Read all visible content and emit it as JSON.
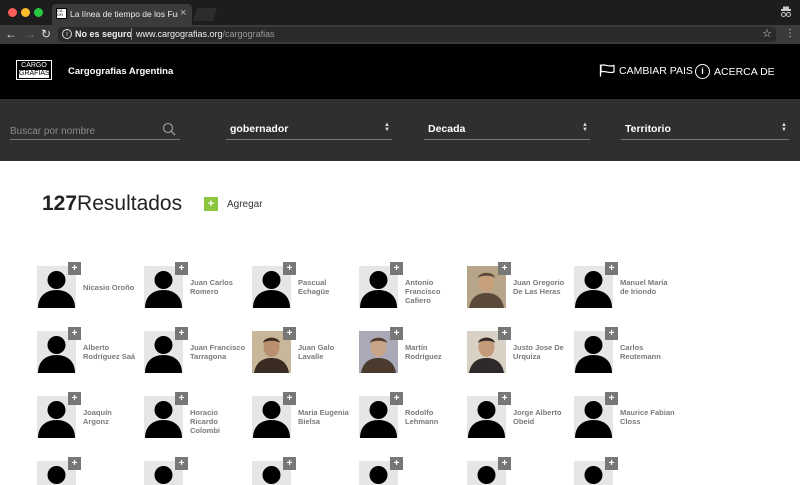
{
  "browser": {
    "tab_title": "La línea de tiempo de los Func",
    "favicon_text": "CA GR",
    "not_secure": "No es seguro",
    "url_host": "www.cargografias.org",
    "url_path": "/cargografias"
  },
  "header": {
    "logo_line1": "CARGO",
    "logo_line2": "GRAFIAS",
    "site_title": "Cargografias Argentina",
    "change_country": "CAMBIAR PAIS",
    "about": "ACERCA DE"
  },
  "filters": {
    "search_placeholder": "Buscar por nombre",
    "cargo": "gobernador",
    "decada": "Decada",
    "territorio": "Territorio"
  },
  "results": {
    "count": "127",
    "label": "Resultados",
    "add_label": "Agregar"
  },
  "people": [
    {
      "name": "Nicasio Oroño",
      "photo": false
    },
    {
      "name": "Juan Carlos Romero",
      "photo": false
    },
    {
      "name": "Pascual Echagüe",
      "photo": false
    },
    {
      "name": "Antonio Francisco Cafiero",
      "photo": false
    },
    {
      "name": "Juan Gregorio De Las Heras",
      "photo": true
    },
    {
      "name": "Manuel María de Iriondo",
      "photo": false
    },
    {
      "name": "Alberto Rodríguez Saá",
      "photo": false
    },
    {
      "name": "Juan Francisco Tarragona",
      "photo": false
    },
    {
      "name": "Juan Galo Lavalle",
      "photo": true
    },
    {
      "name": "Martín Rodríguez",
      "photo": true
    },
    {
      "name": "Justo Jose De Urquiza",
      "photo": true
    },
    {
      "name": "Carlos Reutemann",
      "photo": false
    },
    {
      "name": "Joaquín Argonz",
      "photo": false
    },
    {
      "name": "Horacio Ricardo Colombi",
      "photo": false
    },
    {
      "name": "Maria Eugenia Bielsa",
      "photo": false
    },
    {
      "name": "Rodolfo Lehmann",
      "photo": false
    },
    {
      "name": "Jorge Alberto Obeid",
      "photo": false
    },
    {
      "name": "Maurice Fabian Closs",
      "photo": false
    },
    {
      "name": "",
      "photo": false
    },
    {
      "name": "",
      "photo": false
    },
    {
      "name": "",
      "photo": false
    },
    {
      "name": "",
      "photo": false
    },
    {
      "name": "",
      "photo": false
    },
    {
      "name": "",
      "photo": false
    }
  ],
  "colors": {
    "header_bg": "#000000",
    "filter_bg": "#2f2f2f",
    "accent_add": "#8cc63f"
  }
}
